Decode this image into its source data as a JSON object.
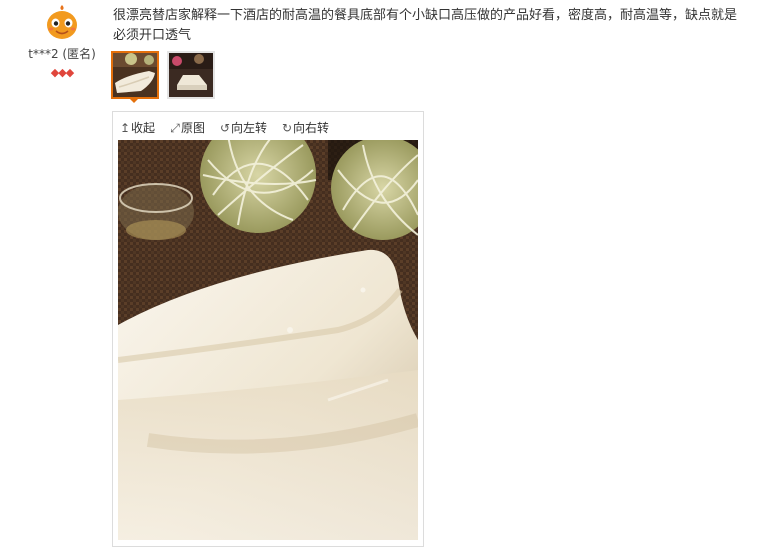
{
  "user": {
    "name": "t***2 (匿名)",
    "rank_icons": [
      "diamond-icon",
      "diamond-icon",
      "diamond-icon"
    ],
    "avatar_color": "#f29a1f"
  },
  "review": {
    "text": "很漂亮替店家解释一下酒店的耐高温的餐具底部有个小缺口高压做的产品好看，密度高，耐高温等，缺点就是必须开口透气"
  },
  "thumbnails": {
    "count": 2,
    "selected_index": 0,
    "selected_border_color": "#e4700b"
  },
  "viewer": {
    "toolbar": {
      "collapse_icon": "↥",
      "collapse_label": "收起",
      "original_icon": "⤢",
      "original_label": "原图",
      "rotate_left_icon": "↺",
      "rotate_left_label": "向左转",
      "rotate_right_icon": "↻",
      "rotate_right_label": "向右转"
    }
  }
}
